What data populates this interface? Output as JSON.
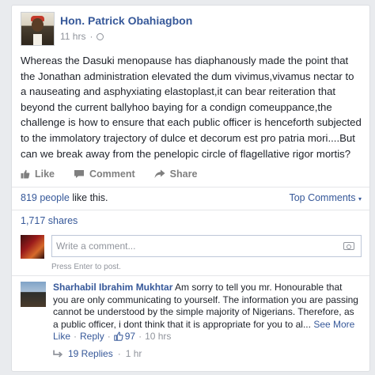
{
  "post": {
    "author": "Hon. Patrick Obahiagbon",
    "time": "11 hrs",
    "text": "Whereas the Dasuki menopause has diaphanously made the point that the Jonathan administration elevated the dum vivimus,vivamus nectar to a nauseating and asphyxiating elastoplast,it can bear reiteration that beyond the current ballyhoo baying for a condign comeuppance,the challenge is how to ensure that each public officer is henceforth subjected to the immolatory trajectory of dulce et decorum est pro patria mori....But can we break away from the penelopic circle of flagellative rigor mortis?"
  },
  "actions": {
    "like": "Like",
    "comment": "Comment",
    "share": "Share"
  },
  "summary": {
    "likes_count": "819 people",
    "likes_suffix": "like this.",
    "top_comments": "Top Comments",
    "shares": "1,717 shares"
  },
  "composer": {
    "placeholder": "Write a comment...",
    "hint": "Press Enter to post."
  },
  "comment": {
    "author": "Sharhabil Ibrahim Mukhtar",
    "text": "Am sorry to tell you mr. Honourable that you are only communicating to yourself. The information you are passing cannot be understood by the simple majority of Nigerians. Therefore, as a public officer, i dont think that it is appropriate for you to al...",
    "see_more": "See More",
    "like": "Like",
    "reply": "Reply",
    "like_count": "97",
    "time": "10 hrs",
    "replies": "19 Replies",
    "replies_time": "1 hr"
  },
  "colors": {
    "link": "#365899",
    "muted": "#90949c",
    "text": "#1d2129"
  }
}
